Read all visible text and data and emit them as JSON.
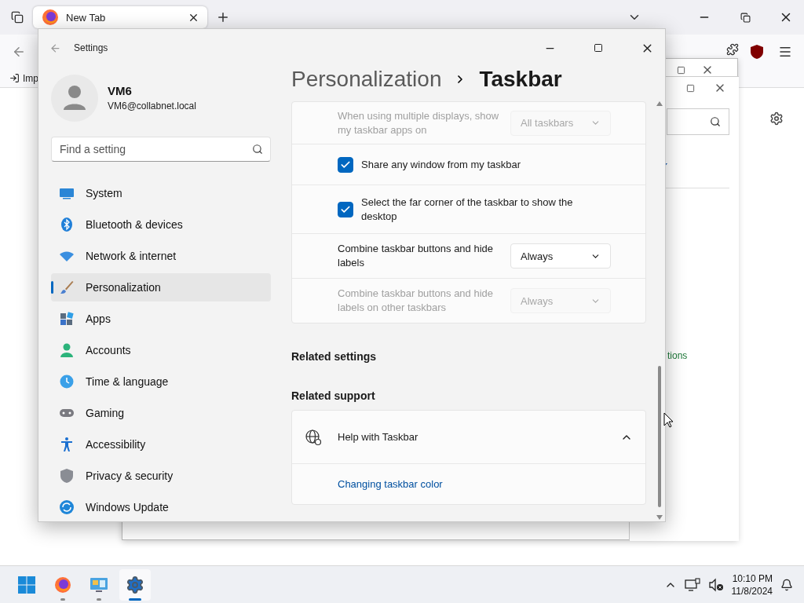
{
  "browser": {
    "tabs": [
      {
        "title": "New Tab",
        "selected": true
      }
    ],
    "bookmark": "Imp"
  },
  "back_window": {
    "link_text": "tions"
  },
  "settings": {
    "title": "Settings",
    "user": {
      "name": "VM6",
      "email": "VM6@collabnet.local"
    },
    "search": {
      "placeholder": "Find a setting"
    },
    "nav": [
      {
        "label": "System",
        "selected": false
      },
      {
        "label": "Bluetooth & devices",
        "selected": false
      },
      {
        "label": "Network & internet",
        "selected": false
      },
      {
        "label": "Personalization",
        "selected": true
      },
      {
        "label": "Apps",
        "selected": false
      },
      {
        "label": "Accounts",
        "selected": false
      },
      {
        "label": "Time & language",
        "selected": false
      },
      {
        "label": "Gaming",
        "selected": false
      },
      {
        "label": "Accessibility",
        "selected": false
      },
      {
        "label": "Privacy & security",
        "selected": false
      },
      {
        "label": "Windows Update",
        "selected": false
      }
    ],
    "breadcrumb": {
      "parent": "Personalization",
      "current": "Taskbar"
    },
    "rows": [
      {
        "kind": "dropdown",
        "label": "When using multiple displays, show my taskbar apps on",
        "value": "All taskbars",
        "disabled": true
      },
      {
        "kind": "checkbox",
        "label": "Share any window from my taskbar",
        "checked": true
      },
      {
        "kind": "checkbox",
        "label": "Select the far corner of the taskbar to show the desktop",
        "checked": true
      },
      {
        "kind": "dropdown",
        "label": "Combine taskbar buttons and hide labels",
        "value": "Always",
        "disabled": false
      },
      {
        "kind": "dropdown",
        "label": "Combine taskbar buttons and hide labels on other taskbars",
        "value": "Always",
        "disabled": true
      }
    ],
    "related_settings": "Related settings",
    "related_support": "Related support",
    "help": {
      "title": "Help with Taskbar",
      "expanded": true,
      "links": [
        "Changing taskbar color"
      ]
    }
  },
  "taskbar": {
    "apps": [
      {
        "active": false
      },
      {
        "active": false
      },
      {
        "active": true
      }
    ],
    "time": "10:10 PM",
    "date": "11/8/2024"
  }
}
